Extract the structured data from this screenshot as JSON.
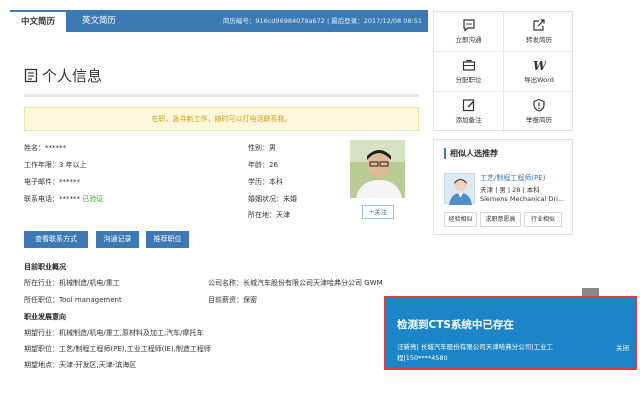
{
  "tabs": [
    {
      "label": "中文简历"
    },
    {
      "label": "英文简历"
    }
  ],
  "resume_meta": "简历编号：916cd96984079a672 | 最后登录：2017/12/08 08:51",
  "section_title": "个人信息",
  "notice": "在职，急寻新工作，随时可以打电话联系我。",
  "profile": {
    "name": "姓名：******",
    "experience": "工作年限：3 年以上",
    "email": "电子邮件：******",
    "phone_label": "联系电话：******",
    "phone_verified": "已验证",
    "gender": "性别：男",
    "age": "年龄：26",
    "education": "学历：本科",
    "marital": "婚姻状况：未婚",
    "location": "所在地：天津"
  },
  "follow_label": "+关注",
  "buttons": {
    "contact": "查看联系方式",
    "communication": "沟通记录",
    "recommend": "推荐职位"
  },
  "current_job": {
    "heading": "目前职业概况",
    "industry": "所在行业：机械制造/机电/重工",
    "company": "公司名称：长城汽车股份有限公司天津哈弗分公司 GWM",
    "position": "所任职位：Tool management",
    "salary": "目前薪资：保密"
  },
  "career_intent": {
    "heading": "职业发展意向",
    "industry": "期望行业：机械制造/机电/重工,原材料及加工,汽车/摩托车",
    "position": "期望职位：工艺/制程工程师(PE),工业工程师(IE),制造工程师",
    "location": "期望地点：天津-开发区,天津-滨海区"
  },
  "actions": [
    {
      "label": "立即沟通",
      "icon": "chat-icon"
    },
    {
      "label": "转发简历",
      "icon": "forward-icon"
    },
    {
      "label": "分配职位",
      "icon": "briefcase-icon"
    },
    {
      "label": "导出Word",
      "icon": "word-icon"
    },
    {
      "label": "添加备注",
      "icon": "edit-note-icon"
    },
    {
      "label": "举报简历",
      "icon": "report-icon"
    }
  ],
  "recommend": {
    "title": "相似人选推荐",
    "name": "工艺/制程工程师(PE)",
    "info": "天津 | 男 | 28 | 本科",
    "company": "Siemens Mechanical Dri...",
    "tags": [
      "经验相似",
      "求职意愿高",
      "行业相似"
    ]
  },
  "popup": {
    "title": "检测到CTS系统中已存在",
    "body": "汪新亮| 长城汽车股份有限公司天津哈弗分公司|工业工程|150****4580",
    "close": "关闭"
  },
  "colors": {
    "brand_blue": "#3d79b5",
    "popup_blue": "#1c85c7",
    "notice_text": "#d49a18",
    "verified_green": "#36a33a",
    "alert_red": "#e03a3a"
  }
}
